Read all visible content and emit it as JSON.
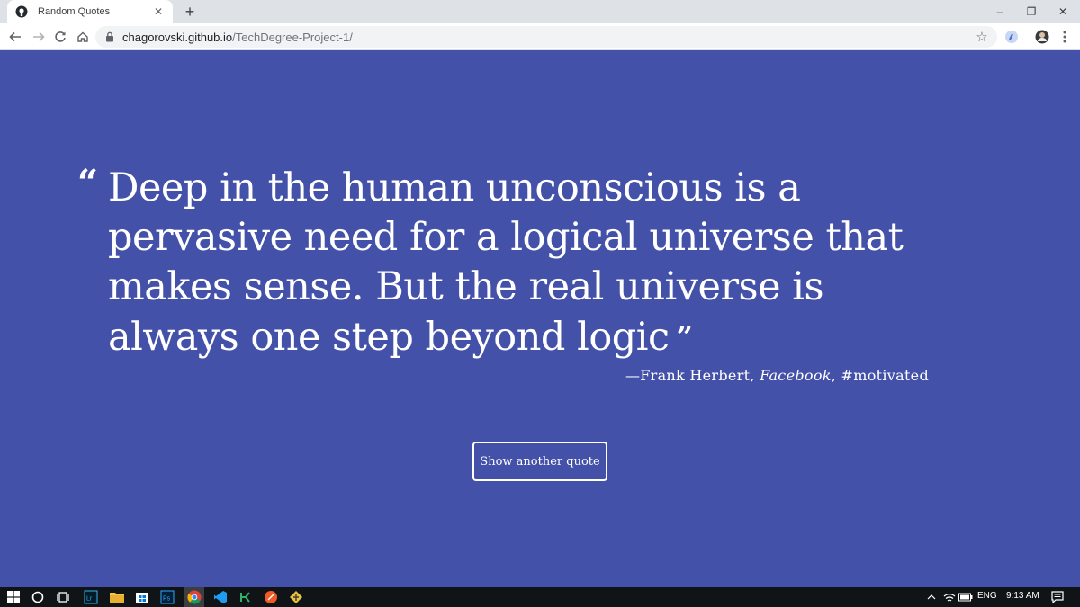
{
  "browser": {
    "tab_title": "Random Quotes",
    "tab_close_label": "✕",
    "new_tab_label": "+",
    "url_host": "chagorovski.github.io",
    "url_path": "/TechDegree-Project-1/"
  },
  "window_controls": {
    "minimize": "–",
    "restore": "❐",
    "close": "✕"
  },
  "quote": {
    "open_mark": "“",
    "text": "Deep in the human unconscious is a pervasive need for a logical universe that makes sense. But the real universe is always one step beyond logic",
    "close_mark": "”",
    "source_prefix": "—Frank Herbert, ",
    "citation": "Facebook",
    "tag_suffix": ", #motivated"
  },
  "button": {
    "label": "Show another quote"
  },
  "taskbar": {
    "language": "ENG",
    "time": "9:13 AM"
  },
  "colors": {
    "page_bg": "#4451a8",
    "text": "#ffffff"
  },
  "icons": {
    "favicon": "github-icon",
    "back": "back-arrow-icon",
    "forward": "forward-arrow-icon",
    "reload": "reload-icon",
    "home": "home-icon",
    "lock": "lock-icon",
    "bookmark": "star-icon",
    "menu": "kebab-menu-icon"
  }
}
